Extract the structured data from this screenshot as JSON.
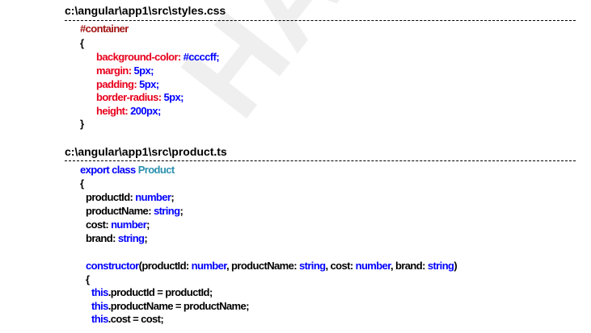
{
  "watermark": "HAR",
  "sections": [
    {
      "file_path": "c:\\angular\\app1\\src\\styles.css",
      "code_lines": [
        {
          "tokens": [
            {
              "t": "#container",
              "c": "dred"
            }
          ]
        },
        {
          "tokens": [
            {
              "t": "{",
              "c": "black"
            }
          ]
        },
        {
          "tokens": [
            {
              "t": "background-color: ",
              "c": "red"
            },
            {
              "t": "#ccccff;",
              "c": "blue"
            }
          ]
        },
        {
          "tokens": [
            {
              "t": "margin: ",
              "c": "red"
            },
            {
              "t": "5px;",
              "c": "blue"
            }
          ]
        },
        {
          "tokens": [
            {
              "t": "padding: ",
              "c": "red"
            },
            {
              "t": "5px;",
              "c": "blue"
            }
          ]
        },
        {
          "tokens": [
            {
              "t": "border-radius: ",
              "c": "red"
            },
            {
              "t": "5px;",
              "c": "blue"
            }
          ]
        },
        {
          "tokens": [
            {
              "t": "height: ",
              "c": "red"
            },
            {
              "t": "200px;",
              "c": "blue"
            }
          ]
        },
        {
          "tokens": [
            {
              "t": "}",
              "c": "black"
            }
          ]
        }
      ]
    },
    {
      "file_path": "c:\\angular\\app1\\src\\product.ts",
      "code_lines": [
        {
          "tokens": [
            {
              "t": "export class ",
              "c": "blue"
            },
            {
              "t": "Product",
              "c": "teal"
            }
          ]
        },
        {
          "tokens": [
            {
              "t": "{",
              "c": "black"
            }
          ]
        },
        {
          "tokens": [
            {
              "t": "productId: ",
              "c": "black"
            },
            {
              "t": "number",
              "c": "blue"
            },
            {
              "t": ";",
              "c": "black"
            }
          ]
        },
        {
          "tokens": [
            {
              "t": "productName: ",
              "c": "black"
            },
            {
              "t": "string",
              "c": "blue"
            },
            {
              "t": ";",
              "c": "black"
            }
          ]
        },
        {
          "tokens": [
            {
              "t": "cost: ",
              "c": "black"
            },
            {
              "t": "number",
              "c": "blue"
            },
            {
              "t": ";",
              "c": "black"
            }
          ]
        },
        {
          "tokens": [
            {
              "t": "brand: ",
              "c": "black"
            },
            {
              "t": "string",
              "c": "blue"
            },
            {
              "t": ";",
              "c": "black"
            }
          ]
        },
        {
          "tokens": []
        },
        {
          "tokens": [
            {
              "t": "constructor",
              "c": "blue"
            },
            {
              "t": "(productId: ",
              "c": "black"
            },
            {
              "t": "number",
              "c": "blue"
            },
            {
              "t": ", productName: ",
              "c": "black"
            },
            {
              "t": "string",
              "c": "blue"
            },
            {
              "t": ", cost: ",
              "c": "black"
            },
            {
              "t": "number",
              "c": "blue"
            },
            {
              "t": ", brand: ",
              "c": "black"
            },
            {
              "t": "string",
              "c": "blue"
            },
            {
              "t": ")",
              "c": "black"
            }
          ]
        },
        {
          "tokens": [
            {
              "t": "{",
              "c": "black"
            }
          ]
        },
        {
          "tokens": [
            {
              "t": "this",
              "c": "blue"
            },
            {
              "t": ".productId = productId;",
              "c": "black"
            }
          ]
        },
        {
          "tokens": [
            {
              "t": "this",
              "c": "blue"
            },
            {
              "t": ".productName = productName;",
              "c": "black"
            }
          ]
        },
        {
          "tokens": [
            {
              "t": "this",
              "c": "blue"
            },
            {
              "t": ".cost = cost;",
              "c": "black"
            }
          ]
        }
      ]
    }
  ]
}
